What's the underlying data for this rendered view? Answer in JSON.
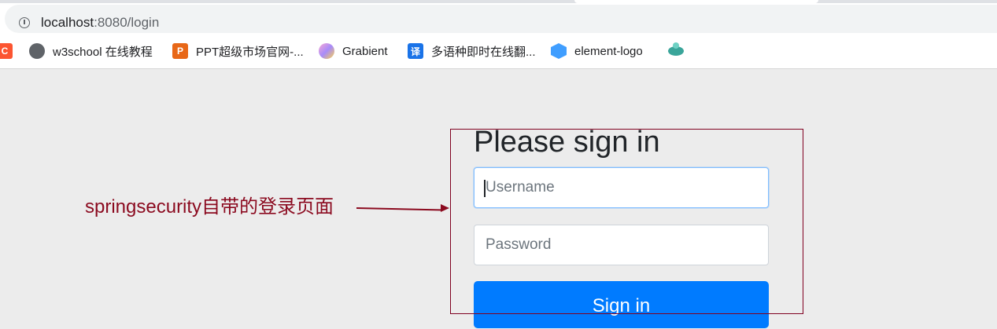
{
  "browser": {
    "url_host": "localhost",
    "url_rest": ":8080/login",
    "bookmarks": [
      {
        "label": "",
        "icon": "csdn-icon"
      },
      {
        "label": "w3school 在线教程",
        "icon": "globe-icon"
      },
      {
        "label": "PPT超级市场官网-...",
        "icon": "ppt-icon"
      },
      {
        "label": "Grabient",
        "icon": "grabient-icon"
      },
      {
        "label": "多语种即时在线翻...",
        "icon": "translate-icon"
      },
      {
        "label": "element-logo",
        "icon": "element-icon"
      },
      {
        "label": "",
        "icon": "saucer-icon"
      }
    ],
    "icon_glyphs": {
      "csdn": "C",
      "ppt": "P",
      "translate": "译"
    }
  },
  "login": {
    "heading": "Please sign in",
    "username_placeholder": "Username",
    "password_placeholder": "Password",
    "signin_label": "Sign in",
    "accent_color": "#007bff"
  },
  "annotation": {
    "text": "springsecurity自带的登录页面",
    "color": "#8b0a1f"
  }
}
